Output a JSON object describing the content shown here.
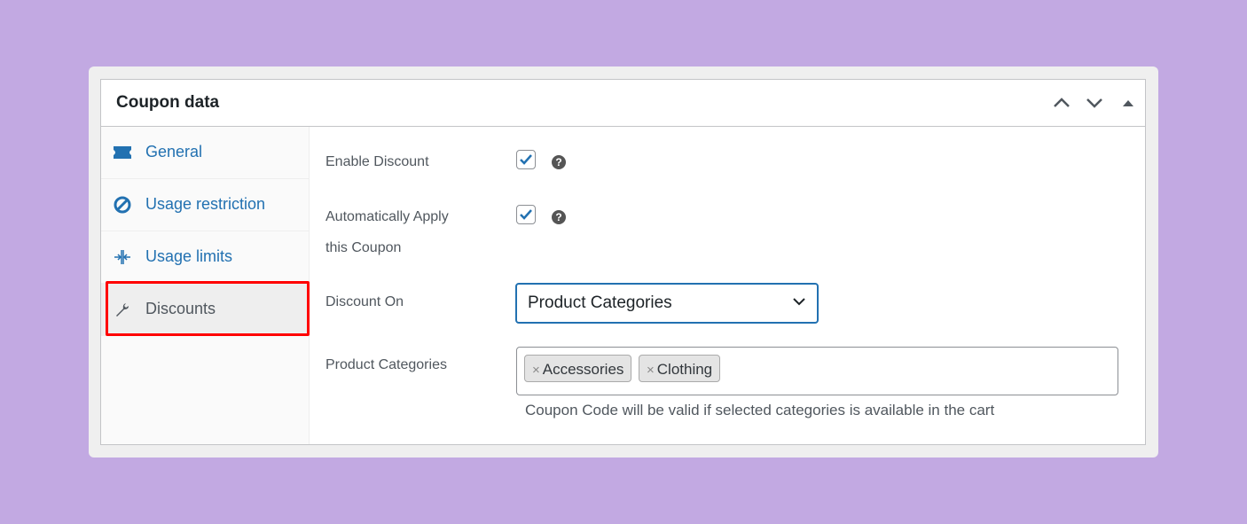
{
  "panel": {
    "title": "Coupon data",
    "header_buttons": [
      "move-up",
      "move-down",
      "toggle-panel"
    ]
  },
  "sidebar": {
    "items": [
      {
        "label": "General",
        "icon": "ticket-icon",
        "active": false
      },
      {
        "label": "Usage restriction",
        "icon": "restriction-icon",
        "active": false
      },
      {
        "label": "Usage limits",
        "icon": "limits-icon",
        "active": false
      },
      {
        "label": "Discounts",
        "icon": "wrench-icon",
        "active": true
      }
    ]
  },
  "form": {
    "enable_discount": {
      "label": "Enable Discount",
      "checked": true,
      "help": "?"
    },
    "auto_apply": {
      "label_line1": "Automatically Apply",
      "label_line2": "this Coupon",
      "checked": true,
      "help": "?"
    },
    "discount_on": {
      "label": "Discount On",
      "value": "Product Categories"
    },
    "product_categories": {
      "label": "Product Categories",
      "selected": [
        {
          "remove": "×",
          "label": "Accessories"
        },
        {
          "remove": "×",
          "label": "Clothing"
        }
      ],
      "description": "Coupon Code will be valid if selected categories is available in the cart"
    }
  },
  "colors": {
    "accent": "#2271b1",
    "highlight": "#ff0000",
    "background": "#c2a9e2"
  }
}
